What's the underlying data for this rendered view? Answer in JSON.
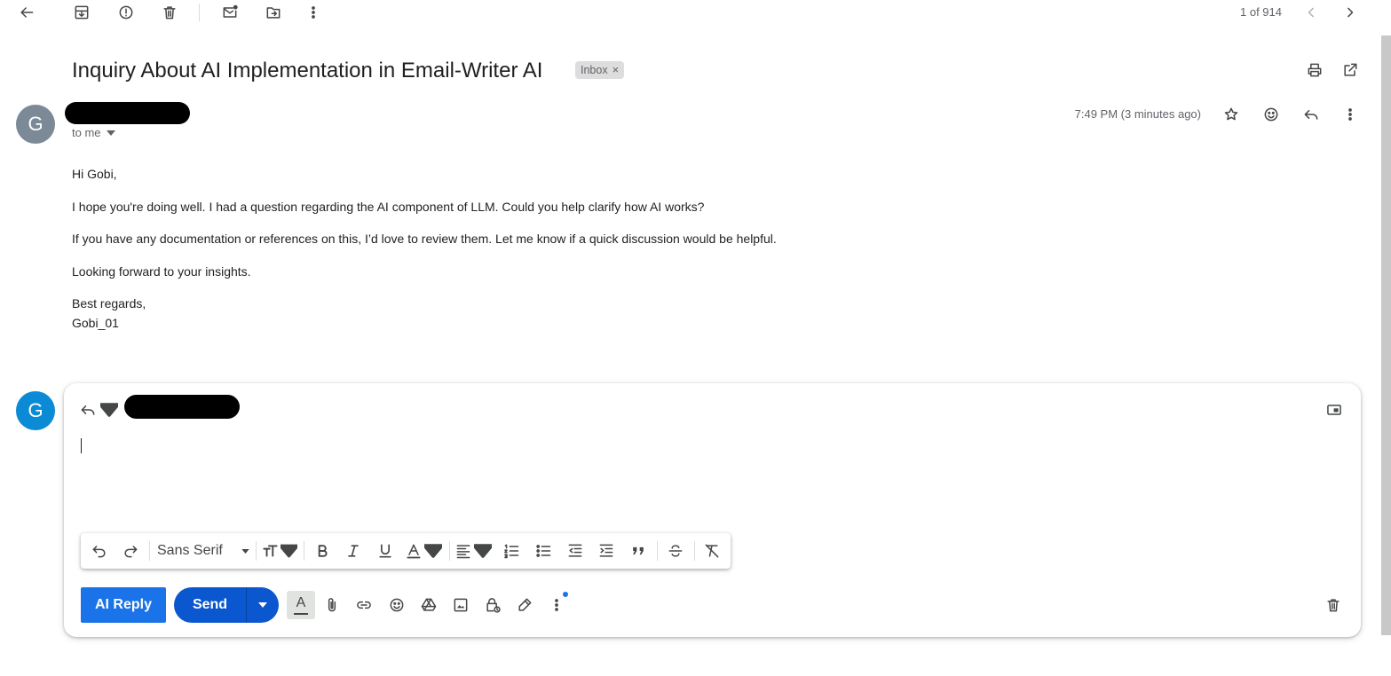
{
  "toolbar": {
    "counter": "1 of 914",
    "icons": [
      "back-arrow-icon",
      "archive-icon",
      "report-spam-icon",
      "trash-icon",
      "mark-unread-icon",
      "move-to-icon",
      "more-vert-icon",
      "chevron-left-icon",
      "chevron-right-icon"
    ]
  },
  "email": {
    "subject": "Inquiry About AI Implementation in Email-Writer AI",
    "label": "Inbox",
    "label_close": "×",
    "sender_avatar": "G",
    "sender_avatar_color": "#7b8a96",
    "recipient": "to me",
    "timestamp": "7:49 PM (3 minutes ago)",
    "body": {
      "greeting": "Hi Gobi,",
      "p1": "I hope you're doing well. I had a question regarding the AI component of LLM. Could you help clarify how AI works?",
      "p2": "If you have any documentation or references on this, I’d love to review them. Let me know if a quick discussion would be helpful.",
      "p3": "Looking forward to your insights.",
      "closing": "Best regards,",
      "signature": "Gobi_01"
    }
  },
  "reply": {
    "avatar": "G",
    "avatar_color": "#0b8bd6",
    "font_family_label": "Sans Serif",
    "ai_reply_label": "AI Reply",
    "send_label": "Send",
    "text_color_glyph": "A"
  },
  "colors": {
    "primary": "#0b57d0",
    "ai_button": "#1a73e8",
    "muted_text": "#5f6368"
  }
}
